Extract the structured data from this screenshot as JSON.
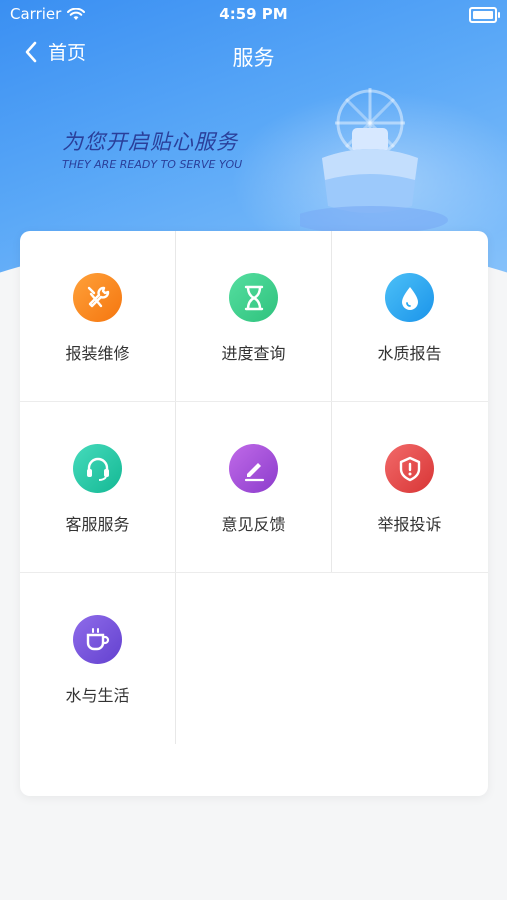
{
  "status_bar": {
    "carrier": "Carrier",
    "time": "4:59 PM"
  },
  "nav": {
    "back_label": "首页",
    "title": "服务"
  },
  "banner": {
    "slogan_cn": "为您开启贴心服务",
    "slogan_en": "THEY ARE READY TO SERVE YOU"
  },
  "services": [
    {
      "label": "报装维修",
      "icon": "tools-icon",
      "color": "#f7931e"
    },
    {
      "label": "进度查询",
      "icon": "hourglass-icon",
      "color": "#3ccf8a"
    },
    {
      "label": "水质报告",
      "icon": "water-drop-icon",
      "color": "#26a9f0"
    },
    {
      "label": "客服服务",
      "icon": "headset-icon",
      "color": "#22c8a6"
    },
    {
      "label": "意见反馈",
      "icon": "edit-icon",
      "color": "#a24fd8"
    },
    {
      "label": "举报投诉",
      "icon": "report-shield-icon",
      "color": "#e94747"
    },
    {
      "label": "水与生活",
      "icon": "coffee-cup-icon",
      "color": "#7a55dc"
    }
  ]
}
